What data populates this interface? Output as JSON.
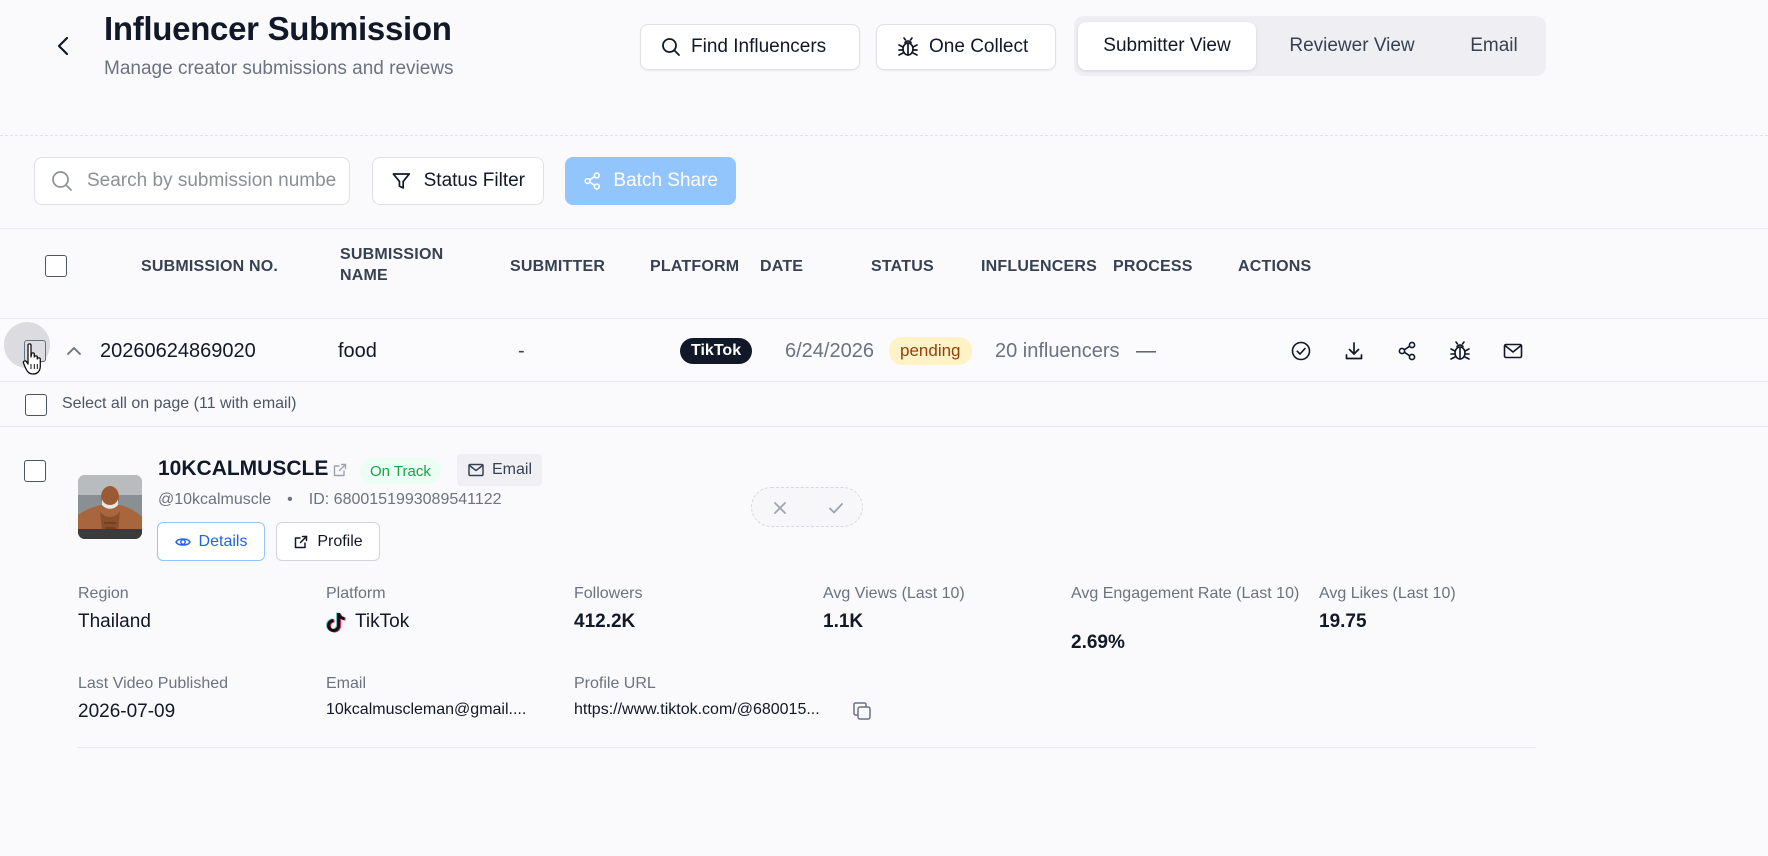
{
  "header": {
    "title": "Influencer Submission",
    "subtitle": "Manage creator submissions and reviews",
    "find_influencers_label": "Find Influencers",
    "one_collect_label": "One Collect",
    "view_tabs": [
      "Submitter View",
      "Reviewer View",
      "Email"
    ],
    "active_view": "Submitter View"
  },
  "toolbar": {
    "search_placeholder": "Search by submission number",
    "status_filter_label": "Status Filter",
    "batch_share_label": "Batch Share"
  },
  "table": {
    "columns": {
      "submission_no": "SUBMISSION NO.",
      "submission_name_1": "SUBMISSION",
      "submission_name_2": "NAME",
      "submitter": "SUBMITTER",
      "platform": "PLATFORM",
      "date": "DATE",
      "status": "STATUS",
      "influencers": "INFLUENCERS",
      "process": "PROCESS",
      "actions": "ACTIONS"
    },
    "row": {
      "submission_no": "20260624869020",
      "submission_name": "food",
      "submitter": "-",
      "platform": "TikTok",
      "date": "6/24/2026",
      "status": "pending",
      "influencers": "20 influencers",
      "process": "—"
    }
  },
  "select_all_label": "Select all on page (11 with email)",
  "influencer": {
    "name": "10KCALMUSCLE",
    "status": "On Track",
    "email_chip": "Email",
    "handle": "@10kcalmuscle",
    "separator": "•",
    "id_text": "ID: 6800151993089541122",
    "details_label": "Details",
    "profile_label": "Profile",
    "stats": {
      "region_label": "Region",
      "region": "Thailand",
      "platform_label": "Platform",
      "platform": "TikTok",
      "followers_label": "Followers",
      "followers": "412.2K",
      "avg_views_label": "Avg Views (Last 10)",
      "avg_views": "1.1K",
      "engagement_label": "Avg Engagement Rate (Last 10)",
      "engagement": "2.69%",
      "avg_likes_label": "Avg Likes (Last 10)",
      "avg_likes": "19.75",
      "last_video_label": "Last Video Published",
      "last_video": "2026-07-09",
      "email_label": "Email",
      "email": "10kcalmuscleman@gmail....",
      "profile_url_label": "Profile URL",
      "profile_url": "https://www.tiktok.com/@680015..."
    }
  },
  "colors": {
    "accent": "#2563eb",
    "batch_share_bg": "#93c5fd",
    "pending_bg": "#fef3c7",
    "on_track": "#16a34a"
  }
}
